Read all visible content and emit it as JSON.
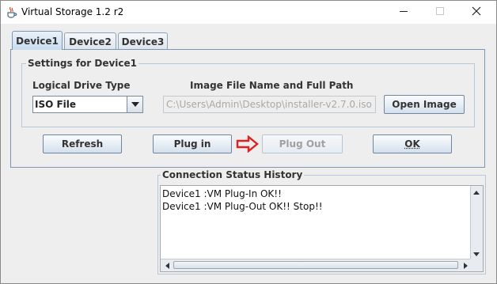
{
  "window": {
    "title": "Virtual Storage 1.2 r2",
    "icon": "java-cup-icon",
    "controls": {
      "minimize": "minimize-icon",
      "maximize": "maximize-icon",
      "close": "close-icon"
    }
  },
  "tabs": [
    {
      "label": "Device1",
      "active": true
    },
    {
      "label": "Device2",
      "active": false
    },
    {
      "label": "Device3",
      "active": false
    }
  ],
  "settings": {
    "group_title": "Settings for Device1",
    "drive_type_label": "Logical Drive Type",
    "drive_type_value": "ISO File",
    "image_path_label": "Image File Name and Full Path",
    "image_path_value": "C:\\Users\\Admin\\Desktop\\installer-v2.7.0.iso",
    "open_image_label": "Open Image"
  },
  "actions": {
    "refresh_label": "Refresh",
    "plug_in_label": "Plug in",
    "plug_out_label": "Plug Out",
    "plug_out_enabled": false,
    "ok_label": "OK"
  },
  "history": {
    "title": "Connection Status History",
    "lines": [
      "Device1 :VM Plug-In OK!!",
      "Device1 :VM Plug-Out OK!! Stop!!"
    ]
  },
  "colors": {
    "accent_border": "#7a96b4",
    "arrow": "#e02020",
    "disabled_text": "#a0a0a0"
  }
}
